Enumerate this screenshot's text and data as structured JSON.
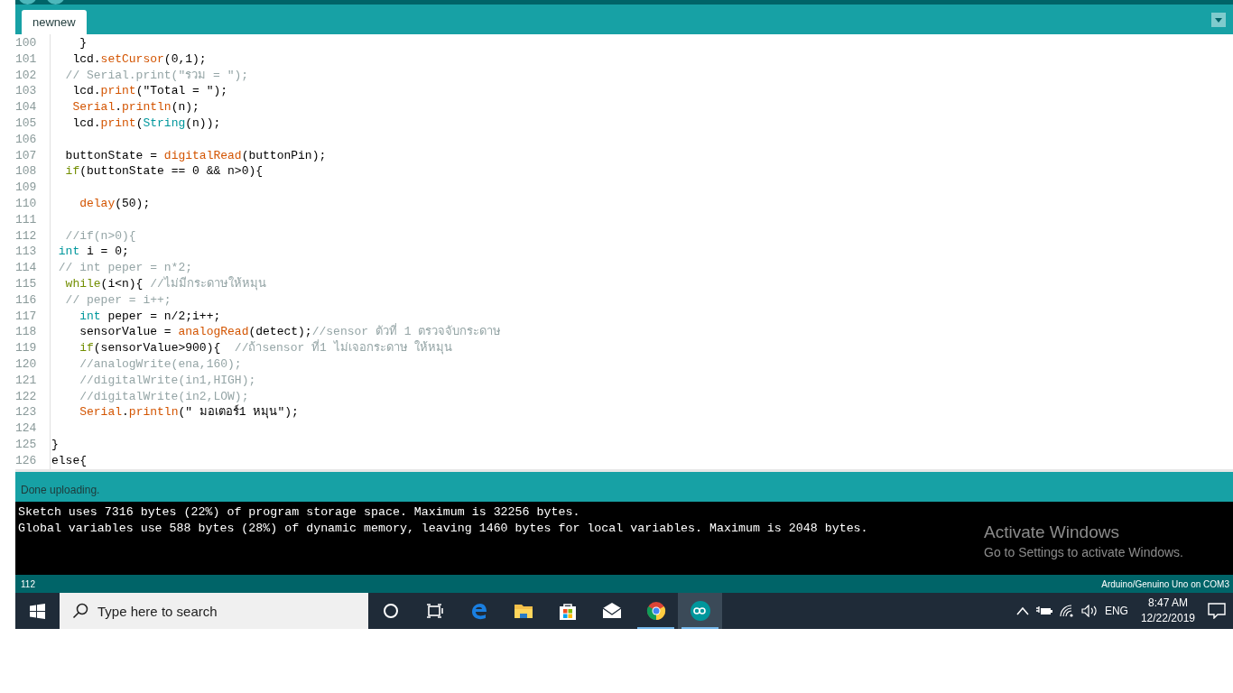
{
  "tabs": [
    {
      "label": "newnew",
      "selected": true
    }
  ],
  "editor": {
    "lines": [
      {
        "number": "100",
        "tokens": [
          {
            "kind": "plain",
            "text": "    }"
          }
        ]
      },
      {
        "number": "101",
        "tokens": [
          {
            "kind": "plain",
            "text": "   lcd."
          },
          {
            "kind": "function",
            "text": "setCursor"
          },
          {
            "kind": "plain",
            "text": "(0,1);"
          }
        ]
      },
      {
        "number": "102",
        "tokens": [
          {
            "kind": "comment",
            "text": "  // Serial.print(\"รวม = \");"
          }
        ]
      },
      {
        "number": "103",
        "tokens": [
          {
            "kind": "plain",
            "text": "   lcd."
          },
          {
            "kind": "function",
            "text": "print"
          },
          {
            "kind": "plain",
            "text": "(\"Total = \");"
          }
        ]
      },
      {
        "number": "104",
        "tokens": [
          {
            "kind": "function",
            "text": "   Serial"
          },
          {
            "kind": "plain",
            "text": "."
          },
          {
            "kind": "function",
            "text": "println"
          },
          {
            "kind": "plain",
            "text": "(n);"
          }
        ]
      },
      {
        "number": "105",
        "tokens": [
          {
            "kind": "plain",
            "text": "   lcd."
          },
          {
            "kind": "function",
            "text": "print"
          },
          {
            "kind": "plain",
            "text": "("
          },
          {
            "kind": "type",
            "text": "String"
          },
          {
            "kind": "plain",
            "text": "(n));"
          }
        ]
      },
      {
        "number": "106"
      },
      {
        "number": "107",
        "tokens": [
          {
            "kind": "plain",
            "text": "  buttonState = "
          },
          {
            "kind": "function",
            "text": "digitalRead"
          },
          {
            "kind": "plain",
            "text": "(buttonPin);"
          }
        ]
      },
      {
        "number": "108",
        "tokens": [
          {
            "kind": "keyword",
            "text": "  if"
          },
          {
            "kind": "plain",
            "text": "(buttonState == 0 && n>0){"
          }
        ]
      },
      {
        "number": "109"
      },
      {
        "number": "110",
        "tokens": [
          {
            "kind": "function",
            "text": "    delay"
          },
          {
            "kind": "plain",
            "text": "(50);"
          }
        ]
      },
      {
        "number": "111"
      },
      {
        "number": "112",
        "tokens": [
          {
            "kind": "comment",
            "text": "  //if(n>0){"
          }
        ]
      },
      {
        "number": "113",
        "tokens": [
          {
            "kind": "type",
            "text": " int"
          },
          {
            "kind": "plain",
            "text": " i = 0;"
          }
        ]
      },
      {
        "number": "114",
        "tokens": [
          {
            "kind": "comment",
            "text": " // int peper = n*2;"
          }
        ]
      },
      {
        "number": "115",
        "tokens": [
          {
            "kind": "keyword",
            "text": "  while"
          },
          {
            "kind": "plain",
            "text": "(i<n){ "
          },
          {
            "kind": "comment",
            "text": "//ไม่มีกระดาษให้หมุน"
          }
        ]
      },
      {
        "number": "116",
        "tokens": [
          {
            "kind": "comment",
            "text": "  // peper = i++;"
          }
        ]
      },
      {
        "number": "117",
        "tokens": [
          {
            "kind": "type",
            "text": "    int"
          },
          {
            "kind": "plain",
            "text": " peper = n/2;i++;"
          }
        ]
      },
      {
        "number": "118",
        "tokens": [
          {
            "kind": "plain",
            "text": "    sensorValue = "
          },
          {
            "kind": "function",
            "text": "analogRead"
          },
          {
            "kind": "plain",
            "text": "(detect);"
          },
          {
            "kind": "comment",
            "text": "//sensor ตัวที่ 1 ตรวจจับกระดาษ"
          }
        ]
      },
      {
        "number": "119",
        "tokens": [
          {
            "kind": "keyword",
            "text": "    if"
          },
          {
            "kind": "plain",
            "text": "(sensorValue>900){  "
          },
          {
            "kind": "comment",
            "text": "//ถ้าsensor ที่1 ไม่เจอกระดาษ ให้หมุน"
          }
        ]
      },
      {
        "number": "120",
        "tokens": [
          {
            "kind": "comment",
            "text": "    //analogWrite(ena,160);"
          }
        ]
      },
      {
        "number": "121",
        "tokens": [
          {
            "kind": "comment",
            "text": "    //digitalWrite(in1,HIGH);"
          }
        ]
      },
      {
        "number": "122",
        "tokens": [
          {
            "kind": "comment",
            "text": "    //digitalWrite(in2,LOW);"
          }
        ]
      },
      {
        "number": "123",
        "tokens": [
          {
            "kind": "function",
            "text": "    Serial"
          },
          {
            "kind": "plain",
            "text": "."
          },
          {
            "kind": "function",
            "text": "println"
          },
          {
            "kind": "plain",
            "text": "(\" มอเตอร์1 หมุน\");"
          }
        ]
      },
      {
        "number": "124"
      },
      {
        "number": "125",
        "tokens": [
          {
            "kind": "plain",
            "text": "}"
          }
        ]
      },
      {
        "number": "126",
        "tokens": [
          {
            "kind": "plain",
            "text": "else{"
          }
        ]
      }
    ]
  },
  "message": "Done uploading.",
  "console": [
    "Sketch uses 7316 bytes (22%) of program storage space. Maximum is 32256 bytes.",
    "Global variables use 588 bytes (28%) of dynamic memory, leaving 1460 bytes for local variables. Maximum is 2048 bytes."
  ],
  "activation": {
    "title": "Activate Windows",
    "subtitle": "Go to Settings to activate Windows."
  },
  "status_bar": {
    "line": "112",
    "board": "Arduino/Genuino Uno on COM3"
  },
  "taskbar": {
    "search": {
      "placeholder": "Type here to search"
    },
    "apps": [
      {
        "kind": "cortana",
        "running": false,
        "selected": false
      },
      {
        "kind": "taskview",
        "running": false,
        "selected": false
      },
      {
        "kind": "edge",
        "running": false,
        "selected": false
      },
      {
        "kind": "explorer",
        "running": false,
        "selected": false
      },
      {
        "kind": "store",
        "running": false,
        "selected": false
      },
      {
        "kind": "mail",
        "running": false,
        "selected": false
      },
      {
        "kind": "chrome",
        "running": true,
        "selected": false
      },
      {
        "kind": "arduino",
        "running": true,
        "selected": true
      }
    ],
    "language": "ENG",
    "time": "8:47 AM",
    "date": "12/22/2019"
  }
}
